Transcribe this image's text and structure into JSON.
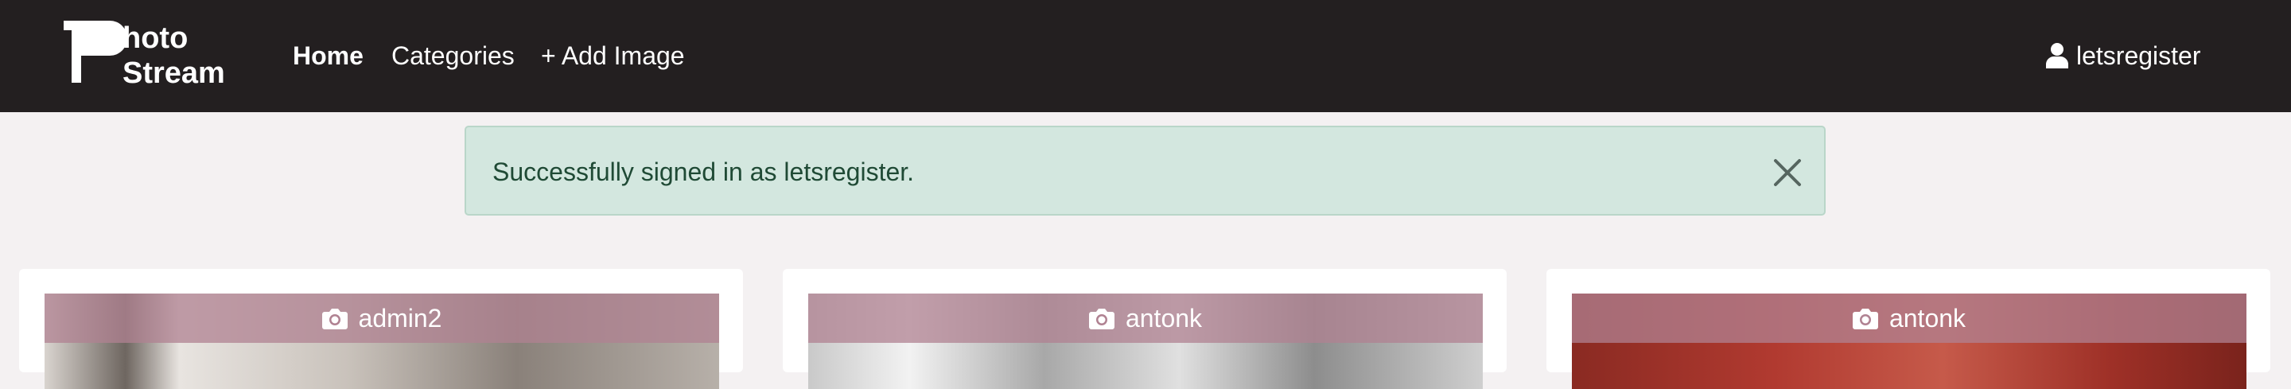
{
  "navbar": {
    "logo_text_line1": "hoto",
    "logo_text_line2": "Stream",
    "links": {
      "home": "Home",
      "categories": "Categories",
      "add_image": "+ Add Image"
    },
    "user": "letsregister",
    "icons": [
      "user-icon"
    ]
  },
  "alert": {
    "message": "Successfully signed in as letsregister.",
    "close_icon": "close-icon"
  },
  "cards": [
    {
      "author": "admin2",
      "icon": "camera-icon"
    },
    {
      "author": "antonk",
      "icon": "camera-icon"
    },
    {
      "author": "antonk",
      "icon": "camera-icon"
    }
  ],
  "colors": {
    "navbar_bg": "#231f20",
    "page_bg": "#f4f1f2",
    "alert_bg": "#d3e7df",
    "alert_text": "#1f4a35",
    "overlay": "#b08292"
  }
}
